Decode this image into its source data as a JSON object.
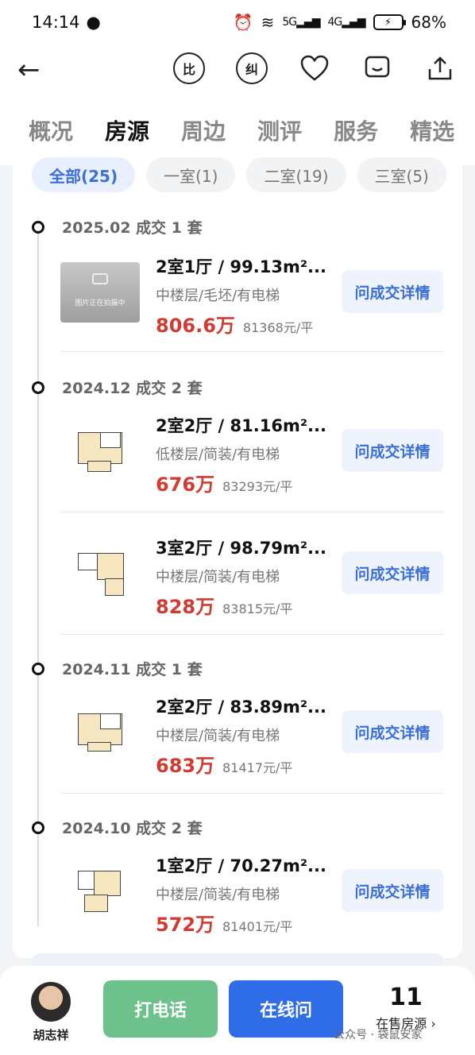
{
  "status_bar": {
    "time": "14:14",
    "battery": "68%",
    "net1": "5G",
    "net2": "4G"
  },
  "toolbar": {
    "icons": [
      "back-arrow-icon",
      "compare-icon",
      "correct-icon",
      "heart-icon",
      "chat-icon",
      "share-icon"
    ],
    "compare": "比",
    "correct": "纠"
  },
  "tabs": [
    "概况",
    "房源",
    "周边",
    "测评",
    "服务",
    "精选"
  ],
  "filters": [
    "全部(25)",
    "一室(1)",
    "二室(19)",
    "三室(5)"
  ],
  "groups": [
    {
      "title": "2025.02 成交 1 套",
      "listings": [
        {
          "title": "2室1厅 / 99.13m²...",
          "specs": "中楼层/毛坯/有电梯",
          "price": "806.6万",
          "unit_price": "81368元/平",
          "thumb_text": "图片正在拍摄中"
        }
      ]
    },
    {
      "title": "2024.12 成交 2 套",
      "listings": [
        {
          "title": "2室2厅 / 81.16m²...",
          "specs": "低楼层/简装/有电梯",
          "price": "676万",
          "unit_price": "83293元/平"
        },
        {
          "title": "3室2厅 / 98.79m²...",
          "specs": "中楼层/简装/有电梯",
          "price": "828万",
          "unit_price": "83815元/平"
        }
      ]
    },
    {
      "title": "2024.11 成交 1 套",
      "listings": [
        {
          "title": "2室2厅 / 83.89m²...",
          "specs": "中楼层/简装/有电梯",
          "price": "683万",
          "unit_price": "81417元/平"
        }
      ]
    },
    {
      "title": "2024.10 成交 2 套",
      "listings": [
        {
          "title": "1室2厅 / 70.27m²...",
          "specs": "中楼层/简装/有电梯",
          "price": "572万",
          "unit_price": "81401元/平"
        }
      ]
    }
  ],
  "detail_button_label": "问成交详情",
  "bottom": {
    "agent_name": "胡志祥",
    "call_label": "打电话",
    "online_label": "在线问",
    "onsale_count": "11",
    "onsale_label": "在售房源 ›"
  },
  "watermark": "公众号 · 袋鼠安家",
  "colors": {
    "accent": "#2f6de8",
    "price": "#d23b32",
    "call": "#6cc28a"
  }
}
